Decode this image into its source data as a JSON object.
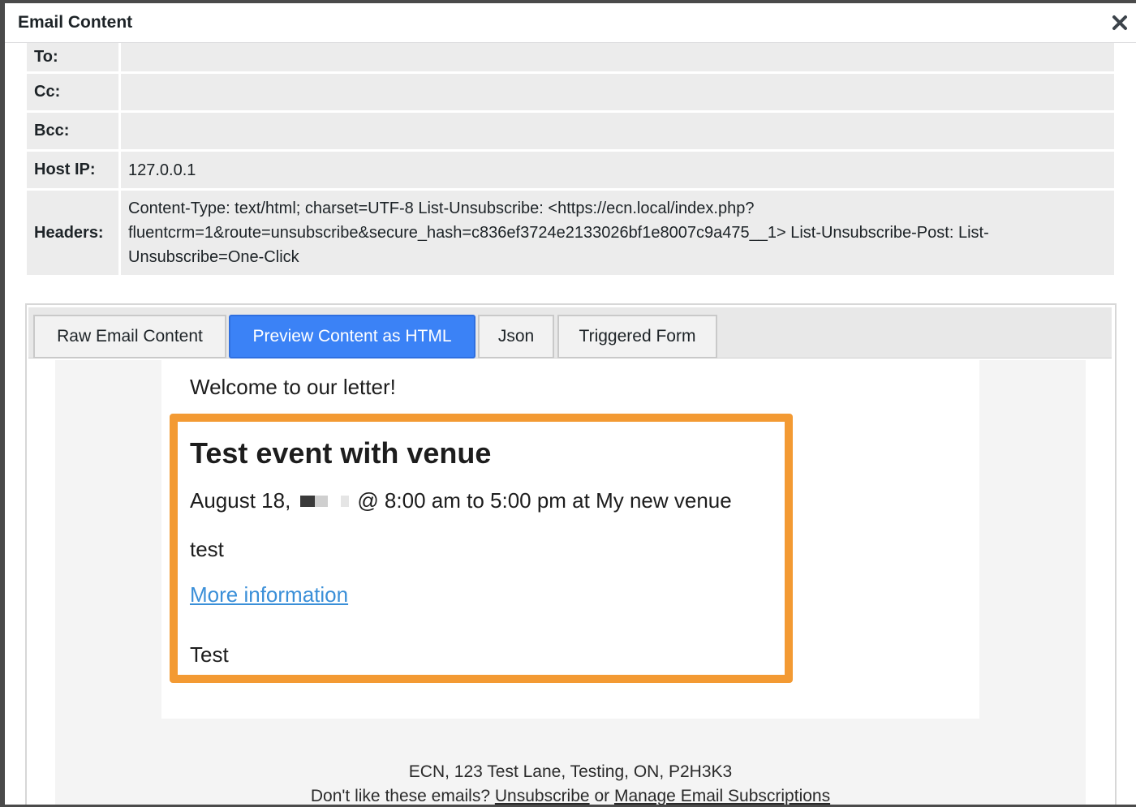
{
  "modal": {
    "title": "Email Content"
  },
  "icons": {
    "close": "close-icon"
  },
  "fields": {
    "to_label": "To:",
    "to_value": "",
    "cc_label": "Cc:",
    "cc_value": "",
    "bcc_label": "Bcc:",
    "bcc_value": "",
    "host_label": "Host IP:",
    "host_value": "127.0.0.1",
    "headers_label": "Headers:",
    "headers_value": "Content-Type: text/html; charset=UTF-8 List-Unsubscribe: <https://ecn.local/index.php?fluentcrm=1&route=unsubscribe&secure_hash=c836ef3724e2133026bf1e8007c9a475__1> List-Unsubscribe-Post: List-Unsubscribe=One-Click"
  },
  "tabs": [
    {
      "label": "Raw Email Content",
      "active": false
    },
    {
      "label": "Preview Content as HTML",
      "active": true
    },
    {
      "label": "Json",
      "active": false
    },
    {
      "label": "Triggered Form",
      "active": false
    }
  ],
  "preview": {
    "welcome": "Welcome to our letter!",
    "event": {
      "title": "Test event with venue",
      "date_prefix": "August 18,",
      "date_suffix": "@ 8:00 am to 5:00 pm at My new venue",
      "description": "test",
      "link_label": "More information",
      "footer_text": "Test"
    },
    "footer": {
      "address": "ECN, 123 Test Lane, Testing, ON, P2H3K3",
      "prefix": "Don't like these emails?",
      "unsubscribe_label": "Unsubscribe",
      "or_text": "or",
      "manage_label": "Manage Email Subscriptions"
    }
  },
  "colors": {
    "active_tab": "#3b82f6",
    "highlight_border": "#f39a33",
    "link": "#3a8fd8"
  }
}
